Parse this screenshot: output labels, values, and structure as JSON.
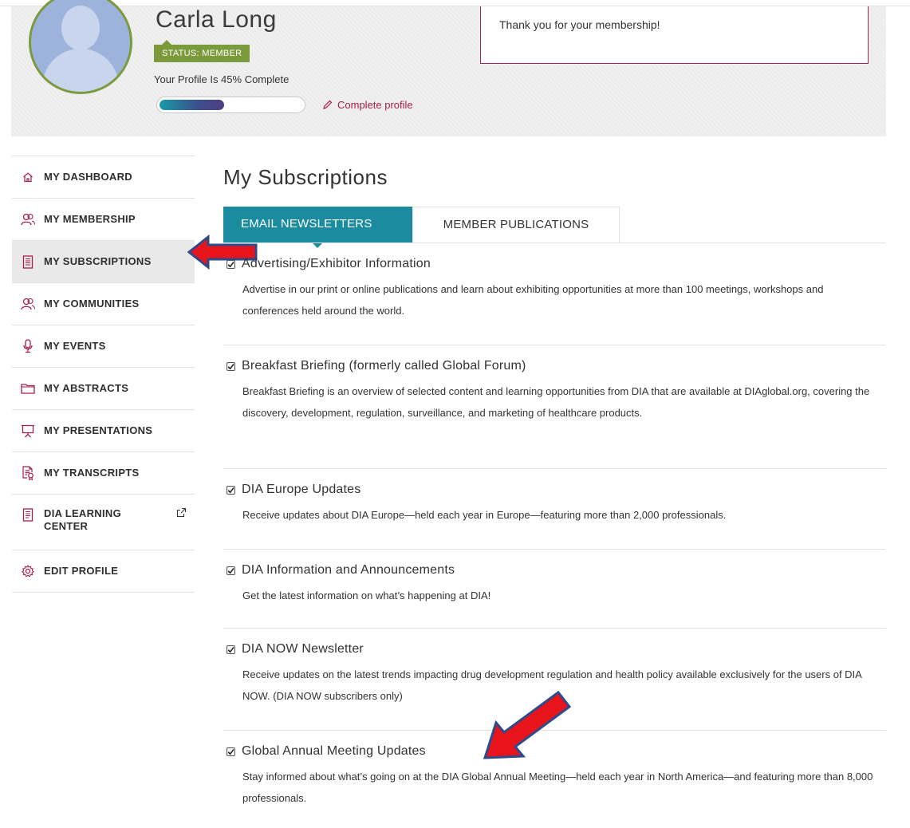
{
  "profile": {
    "name": "Carla Long",
    "status": "STATUS: MEMBER",
    "complete_text": "Your Profile Is 45% Complete",
    "complete_percent": 45,
    "complete_link": "Complete profile",
    "thank_you": "Thank you for your membership!"
  },
  "sidebar": {
    "items": [
      {
        "label": "MY DASHBOARD",
        "icon": "home-icon"
      },
      {
        "label": "MY MEMBERSHIP",
        "icon": "users-icon"
      },
      {
        "label": "MY SUBSCRIPTIONS",
        "icon": "newspaper-icon",
        "active": true
      },
      {
        "label": "MY COMMUNITIES",
        "icon": "users-icon"
      },
      {
        "label": "MY EVENTS",
        "icon": "microphone-icon"
      },
      {
        "label": "MY ABSTRACTS",
        "icon": "folder-icon"
      },
      {
        "label": "MY PRESENTATIONS",
        "icon": "presentation-icon"
      },
      {
        "label": "MY TRANSCRIPTS",
        "icon": "certificate-icon"
      },
      {
        "label": "DIA LEARNING CENTER",
        "label_line1": "DIA LEARNING",
        "label_line2": "CENTER",
        "icon": "document-icon",
        "external": true
      },
      {
        "label": "EDIT PROFILE",
        "icon": "gear-icon"
      }
    ]
  },
  "main": {
    "title": "My Subscriptions",
    "tabs": [
      {
        "label": "EMAIL NEWSLETTERS",
        "active": true
      },
      {
        "label": "MEMBER PUBLICATIONS",
        "active": false
      }
    ],
    "subscriptions": [
      {
        "title": "Advertising/Exhibitor Information",
        "checked": true,
        "description": "Advertise in our print or online publications and learn about exhibiting opportunities at more than 100 meetings, workshops and conferences held around the world."
      },
      {
        "title": "Breakfast Briefing (formerly called Global Forum)",
        "checked": true,
        "description": "Breakfast Briefing is an overview of selected content and learning opportunities from DIA that are available at DIAglobal.org, covering the discovery, development, regulation, surveillance, and marketing of healthcare products."
      },
      {
        "title": "DIA Europe Updates",
        "checked": true,
        "description": "Receive updates about DIA Europe—held each year in Europe—featuring more than 2,000 professionals."
      },
      {
        "title": "DIA Information and Announcements",
        "checked": true,
        "description": "Get the latest information on what’s happening at DIA!"
      },
      {
        "title": "DIA NOW Newsletter",
        "checked": true,
        "description": "Receive updates on the latest trends impacting drug development regulation and health policy available exclusively for the users of DIA NOW. (DIA NOW subscribers only)"
      },
      {
        "title": "Global Annual Meeting Updates",
        "checked": true,
        "description": "Stay informed about what’s going on at the DIA Global Annual Meeting—held each year in North America—and featuring more than 8,000 professionals."
      }
    ]
  },
  "colors": {
    "accent_teal": "#1b8ca0",
    "brand_green": "#7a9a3c",
    "brand_maroon": "#a3214a",
    "annotation_red": "#e8141c"
  }
}
